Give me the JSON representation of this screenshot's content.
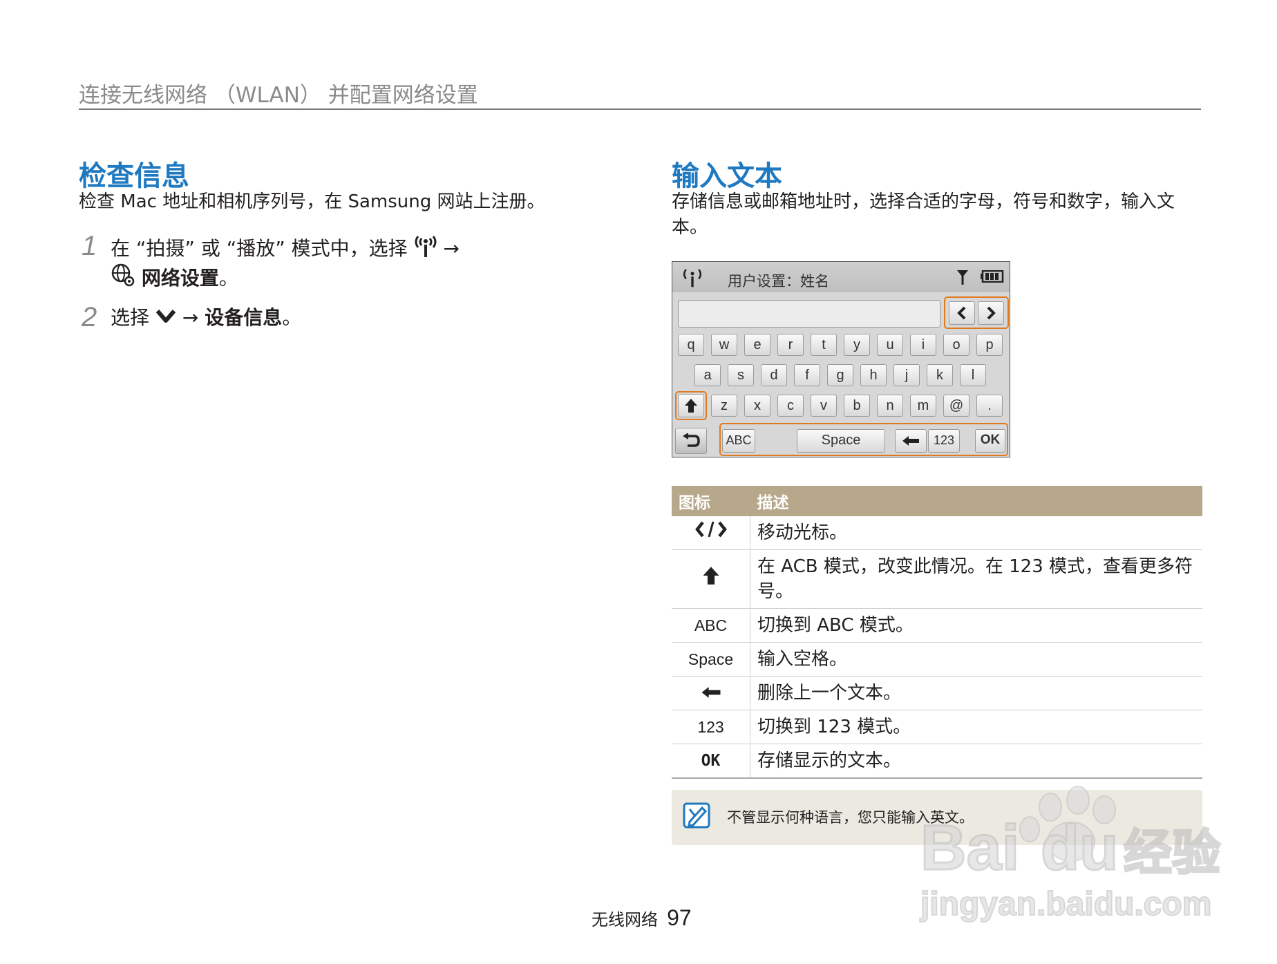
{
  "header": {
    "title": "连接无线网络 （WLAN） 并配置网络设置"
  },
  "left": {
    "heading": "检查信息",
    "description": "检查 Mac 地址和相机序列号，在 Samsung 网站上注册。",
    "steps": [
      {
        "num": "1",
        "pre": "在 “拍摄” 或 “播放” 模式中，选择",
        "arrow": "→",
        "bold": "网络设置",
        "end": "。"
      },
      {
        "num": "2",
        "pre": "选择",
        "arrow": "→",
        "bold": "设备信息",
        "end": "。"
      }
    ]
  },
  "right": {
    "heading": "输入文本",
    "description": "存储信息或邮箱地址时，选择合适的字母，符号和数字，输入文本。",
    "camera": {
      "title": "用户设置：姓名",
      "row1": [
        "q",
        "w",
        "e",
        "r",
        "t",
        "y",
        "u",
        "i",
        "o",
        "p"
      ],
      "row2": [
        "a",
        "s",
        "d",
        "f",
        "g",
        "h",
        "j",
        "k",
        "l"
      ],
      "row3": [
        "z",
        "x",
        "c",
        "v",
        "b",
        "n",
        "m",
        "@",
        "."
      ],
      "abc": "ABC",
      "space": "Space",
      "num": "123",
      "ok": "OK"
    },
    "table": {
      "headers": [
        "图标",
        "描述"
      ],
      "rows": [
        {
          "icon": "",
          "desc": "移动光标。"
        },
        {
          "icon": "",
          "desc": "在 ACB 模式，改变此情况。在 123 模式，查看更多符号。"
        },
        {
          "icon": "ABC",
          "desc": "切换到 ABC 模式。"
        },
        {
          "icon": "Space",
          "desc": "输入空格。"
        },
        {
          "icon": "",
          "desc": "删除上一个文本。"
        },
        {
          "icon": "123",
          "desc": "切换到 123 模式。"
        },
        {
          "icon": "OK",
          "desc": "存储显示的文本。"
        }
      ]
    },
    "note": "不管显示何种语言，您只能输入英文。"
  },
  "footer": {
    "section": "无线网络",
    "page": "97"
  },
  "watermark": {
    "brand": "Baidu经验",
    "url": "jingyan.baidu.com"
  },
  "colors": {
    "heading": "#1f79c1",
    "table_header": "#b7a88b",
    "highlight": "#e07a1f"
  }
}
